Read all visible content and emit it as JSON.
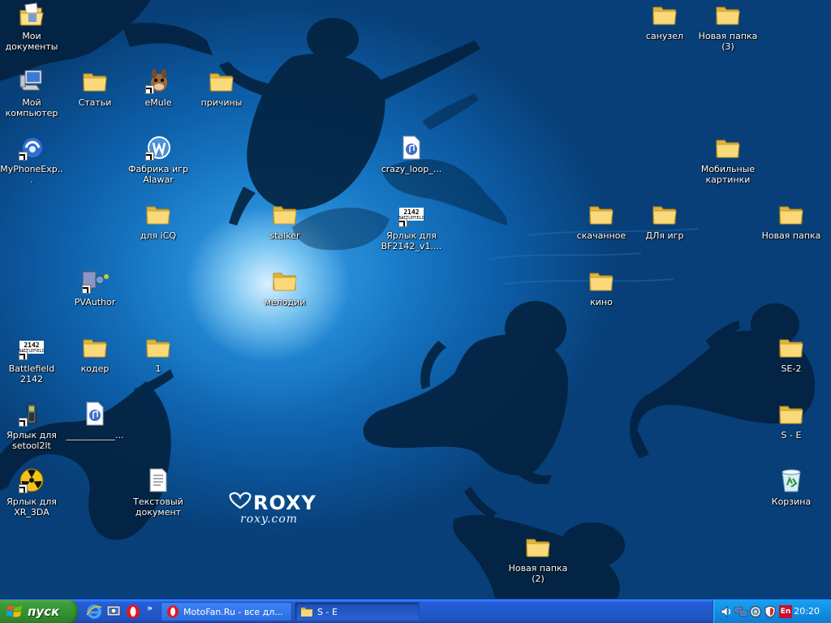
{
  "desktop": {
    "icons": [
      {
        "id": "my-documents",
        "label": "Мои документы",
        "icon": "my-documents-icon"
      },
      {
        "id": "my-computer",
        "label": "Мой компьютер",
        "icon": "my-computer-icon"
      },
      {
        "id": "myphoneexp",
        "label": "MyPhoneExp...",
        "icon": "myphoneexplorer-icon"
      },
      {
        "id": "stati",
        "label": "Статьи",
        "icon": "folder-icon"
      },
      {
        "id": "emule",
        "label": "eMule",
        "icon": "emule-icon"
      },
      {
        "id": "prichiny",
        "label": "причины",
        "icon": "folder-icon"
      },
      {
        "id": "alawar",
        "label": "Фабрика игр Alawar",
        "icon": "alawar-icon"
      },
      {
        "id": "crazy-loop",
        "label": "crazy_loop_...",
        "icon": "audio-file-icon"
      },
      {
        "id": "dlya-icq",
        "label": "для iCQ",
        "icon": "folder-icon"
      },
      {
        "id": "stalker",
        "label": "stalker",
        "icon": "folder-icon"
      },
      {
        "id": "bf2142-shortcut",
        "label": "Ярлык для BF2142_v1....",
        "icon": "battlefield-icon"
      },
      {
        "id": "skachannoe",
        "label": "скачанное",
        "icon": "folder-icon"
      },
      {
        "id": "dlya-igr",
        "label": "ДЛя игр",
        "icon": "folder-icon"
      },
      {
        "id": "novaya-papka",
        "label": "Новая папка",
        "icon": "folder-icon"
      },
      {
        "id": "sanuzel",
        "label": "санузел",
        "icon": "folder-icon"
      },
      {
        "id": "novaya-papka-3",
        "label": "Новая папка (3)",
        "icon": "folder-icon"
      },
      {
        "id": "mobile-pics",
        "label": "Мобильные картинки",
        "icon": "folder-icon"
      },
      {
        "id": "pvauthor",
        "label": "PVAuthor",
        "icon": "pvauthor-icon"
      },
      {
        "id": "melodii",
        "label": "мелодии",
        "icon": "folder-icon"
      },
      {
        "id": "kino",
        "label": "кино",
        "icon": "folder-icon"
      },
      {
        "id": "bf2142",
        "label": "Battlefield 2142",
        "icon": "battlefield-icon"
      },
      {
        "id": "koder",
        "label": "кодер",
        "icon": "folder-icon"
      },
      {
        "id": "folder-1",
        "label": "1",
        "icon": "folder-icon"
      },
      {
        "id": "se-2",
        "label": "SE-2",
        "icon": "folder-icon"
      },
      {
        "id": "setool",
        "label": "Ярлык для setool2lt",
        "icon": "phone-tool-icon"
      },
      {
        "id": "underscore",
        "label": "___________...",
        "icon": "audio-file-icon"
      },
      {
        "id": "s-e",
        "label": "S - E",
        "icon": "folder-icon"
      },
      {
        "id": "xr3da",
        "label": "Ярлык для XR_3DA",
        "icon": "radiation-icon"
      },
      {
        "id": "text-doc",
        "label": "Текстовый документ",
        "icon": "text-document-icon"
      },
      {
        "id": "recycle-bin",
        "label": "Корзина",
        "icon": "recycle-bin-icon"
      },
      {
        "id": "novaya-papka-2",
        "label": "Новая папка (2)",
        "icon": "folder-icon"
      }
    ]
  },
  "wallpaper": {
    "brand": "ROXY",
    "url": "roxy.com"
  },
  "taskbar": {
    "start_label": "пуск",
    "quick_launch": [
      "internet-explorer-icon",
      "show-desktop-icon",
      "opera-icon"
    ],
    "quick_launch_more": "»",
    "tasks": [
      {
        "label": "MotoFan.Ru - все дл...",
        "icon": "opera-icon",
        "active": false
      },
      {
        "label": "S - E",
        "icon": "folder-icon",
        "active": true
      }
    ]
  },
  "tray": {
    "language": "En",
    "time": "20:20",
    "icons": [
      "volume-icon",
      "network-icon",
      "sync-icon",
      "antivirus-icon"
    ]
  },
  "colors": {
    "taskbar_blue": "#245edc",
    "start_green": "#3c9e3c",
    "tray_blue": "#118fe3",
    "folder_yellow": "#f7d672"
  }
}
